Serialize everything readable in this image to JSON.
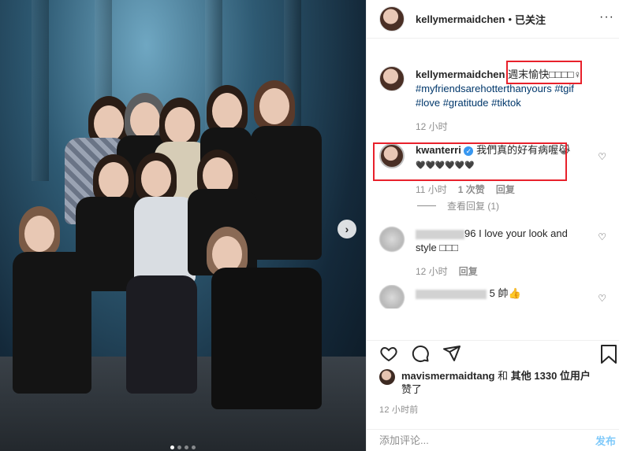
{
  "post": {
    "author": "kellymermaidchen",
    "separator": "•",
    "follow_state": "已关注",
    "more_glyph": "···",
    "caption": {
      "username": "kellymermaidchen",
      "text": "週末愉快□□□□♀",
      "hashtags_line1": "#myfriendsarehotterthanyours #tgif",
      "hashtags_line2": "#love #gratitude #tiktok",
      "time": "12 小时"
    }
  },
  "comments": [
    {
      "username": "kwanterri",
      "verified": true,
      "text": "我們真的好有病喔😹",
      "hearts": "🖤🖤🖤🖤🖤🖤",
      "time": "11 小时",
      "likes": "1 次赞",
      "reply": "回复",
      "view_replies": "查看回复 (1)"
    },
    {
      "username_visible": "96",
      "text_line1": "I love your look and",
      "text_line2": "style □□□",
      "time": "12 小时",
      "reply": "回复"
    },
    {
      "username_visible": "5 帥",
      "emoji": "👍"
    }
  ],
  "likes": {
    "user": "mavismermaidtang",
    "connector": "和",
    "others": "其他 1330 位用户",
    "suffix": "赞了"
  },
  "time_ago": "12 小时前",
  "comment_input": {
    "placeholder": "添加评论...",
    "post_label": "发布"
  },
  "carousel": {
    "dots": 4,
    "active": 0
  }
}
